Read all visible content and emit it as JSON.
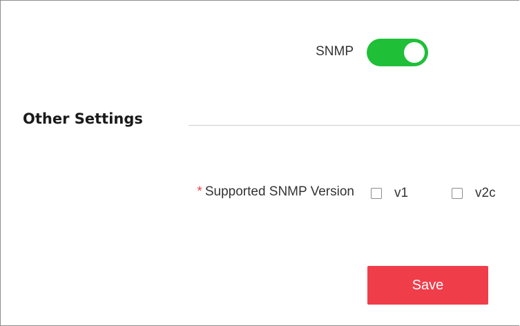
{
  "snmp": {
    "label": "SNMP",
    "enabled": true,
    "toggle_color": "#1fbf38"
  },
  "other_settings": {
    "title": "Other Settings",
    "supported_version": {
      "required_mark": "*",
      "label": "Supported SNMP Version",
      "options": [
        {
          "label": "v1",
          "checked": false
        },
        {
          "label": "v2c",
          "checked": false
        }
      ]
    }
  },
  "actions": {
    "save_label": "Save",
    "save_color": "#f03d4a"
  }
}
